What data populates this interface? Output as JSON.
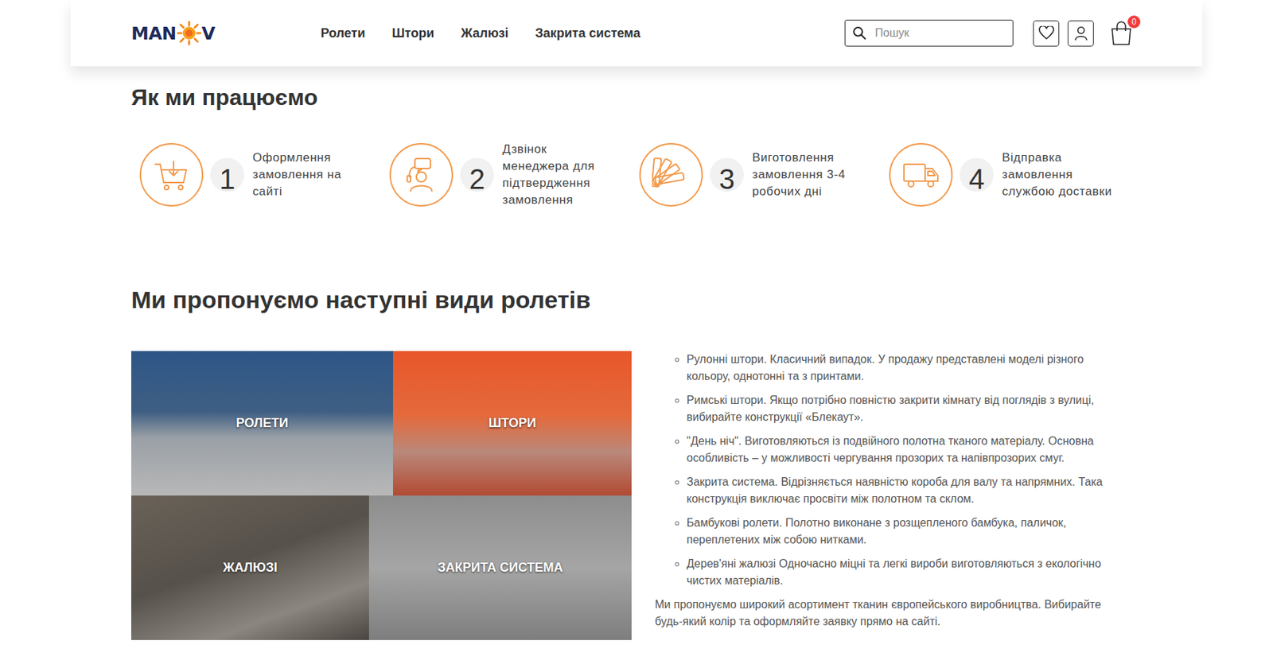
{
  "header": {
    "logo": {
      "left": "MAN",
      "right": "V"
    },
    "nav": [
      {
        "label": "Ролети"
      },
      {
        "label": "Штори"
      },
      {
        "label": "Жалюзі"
      },
      {
        "label": "Закрита система"
      }
    ],
    "search": {
      "placeholder": "Пошук"
    },
    "cart": {
      "count": "0"
    }
  },
  "how_we_work": {
    "title": "Як ми працюємо",
    "steps": [
      {
        "number": "1",
        "text": "Оформлення замовлення на сайті",
        "kind": "cart"
      },
      {
        "number": "2",
        "text": "Дзвінок менеджера для підтвердження замовлення",
        "kind": "call"
      },
      {
        "number": "3",
        "text": "Виготовлення замовлення 3-4 робочих дні",
        "kind": "swatch"
      },
      {
        "number": "4",
        "text": "Відправка замовлення службою доставки",
        "kind": "truck"
      }
    ]
  },
  "types": {
    "title": "Ми пропонуємо наступні види ролетів",
    "tiles": [
      {
        "label": "РОЛЕТИ"
      },
      {
        "label": "ШТОРИ"
      },
      {
        "label": "ЖАЛЮЗІ"
      },
      {
        "label": "ЗАКРИТА СИСТЕМА"
      }
    ],
    "list": [
      "Рулонні штори. Класичний випадок. У продажу представлені моделі різного кольору, однотонні та з принтами.",
      "Римські штори. Якщо потрібно повністю закрити кімнату від поглядів з вулиці, вибирайте конструкції «Блекаут».",
      "\"День ніч\". Виготовляються із подвійного полотна тканого матеріалу. Основна особливість – у можливості чергування прозорих та напівпрозорих смуг.",
      "Закрита система. Відрізняється наявністю короба для валу та напрямних. Така конструкція виключає просвіти між полотном та склом.",
      "Бамбукові ролети. Полотно виконане з розщепленого бамбука, паличок, переплетених між собою нитками.",
      "Дерев'яні жалюзі Одночасно міцні та легкі вироби виготовляються з екологічно чистих матеріалів."
    ],
    "note": "Ми пропонуємо широкий асортимент тканин європейського виробництва. Вибирайте будь-який колір та оформляйте заявку прямо на сайті."
  }
}
